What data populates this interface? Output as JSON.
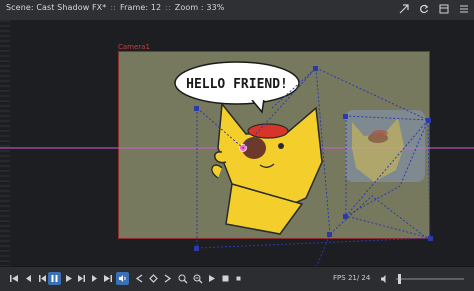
{
  "titlebar": {
    "scene": "Scene: Cast Shadow FX*",
    "frame": "Frame: 12",
    "zoom": "Zoom : 33%",
    "separator": "::"
  },
  "camera": {
    "label": "Camera1"
  },
  "speech_bubble": {
    "text": "HELLO FRIEND!"
  },
  "toolbar": {
    "fps_label": "FPS",
    "fps_value": "21/ 24"
  },
  "colors": {
    "stage": "#76795e",
    "accent": "#3b6fb6",
    "camera": "#c44040",
    "guide": "#d060d0"
  },
  "icons": [
    "first-frame-icon",
    "prev-frame-icon",
    "pause-icon",
    "play-icon",
    "next-frame-icon",
    "last-frame-icon",
    "loop-icon",
    "sound-icon",
    "prev-key-icon",
    "key-icon",
    "next-key-icon",
    "zoom-in-icon",
    "zoom-out-icon",
    "play-range-icon",
    "stop-icon",
    "speaker-icon"
  ]
}
